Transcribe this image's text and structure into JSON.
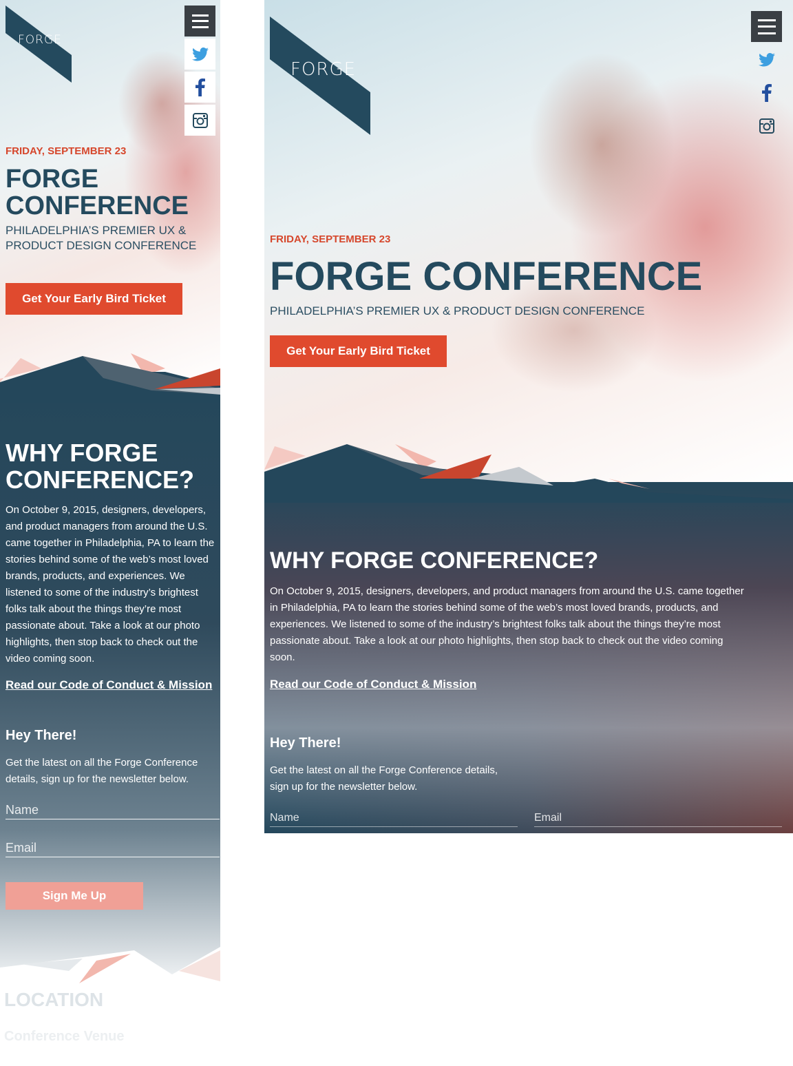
{
  "brand": {
    "logo_text": "FORGE",
    "primary": "#244a5e",
    "accent": "#e04a2e",
    "signup_color": "#f0a096"
  },
  "social": {
    "menu_icon": "hamburger-menu-icon",
    "twitter_icon": "twitter-icon",
    "facebook_icon": "facebook-icon",
    "instagram_icon": "instagram-icon"
  },
  "hero": {
    "date": "FRIDAY, SEPTEMBER 23",
    "title": "FORGE CONFERENCE",
    "mobile_title_line1": "FORGE",
    "mobile_title_line2": "CONFERENCE",
    "subtitle": "PHILADELPHIA’S PREMIER UX & PRODUCT DESIGN CONFERENCE",
    "mobile_subtitle_line1": "PHILADELPHIA’S PREMIER UX &",
    "mobile_subtitle_line2": "PRODUCT DESIGN CONFERENCE",
    "cta": "Get Your Early Bird Ticket"
  },
  "why": {
    "title": "WHY FORGE CONFERENCE?",
    "mobile_title_line1": "WHY FORGE",
    "mobile_title_line2": "CONFERENCE?",
    "body": "On October 9, 2015, designers, developers, and product managers from around the U.S. came together in Philadelphia, PA to learn the stories behind some of the web’s most loved brands, products, and experiences. We listened to some of the industry’s brightest folks talk about the things they’re most passionate about. Take a look at our photo highlights, then stop back to check out the video coming soon.",
    "link": "Read our Code of Conduct & Mission"
  },
  "newsletter": {
    "title": "Hey There!",
    "body": "Get the latest on all the Forge Conference details, sign up for the newsletter below.",
    "name_placeholder": "Name",
    "email_placeholder": "Email",
    "button": "Sign Me Up"
  },
  "location": {
    "title": "LOCATION",
    "venue": "Conference Venue"
  }
}
